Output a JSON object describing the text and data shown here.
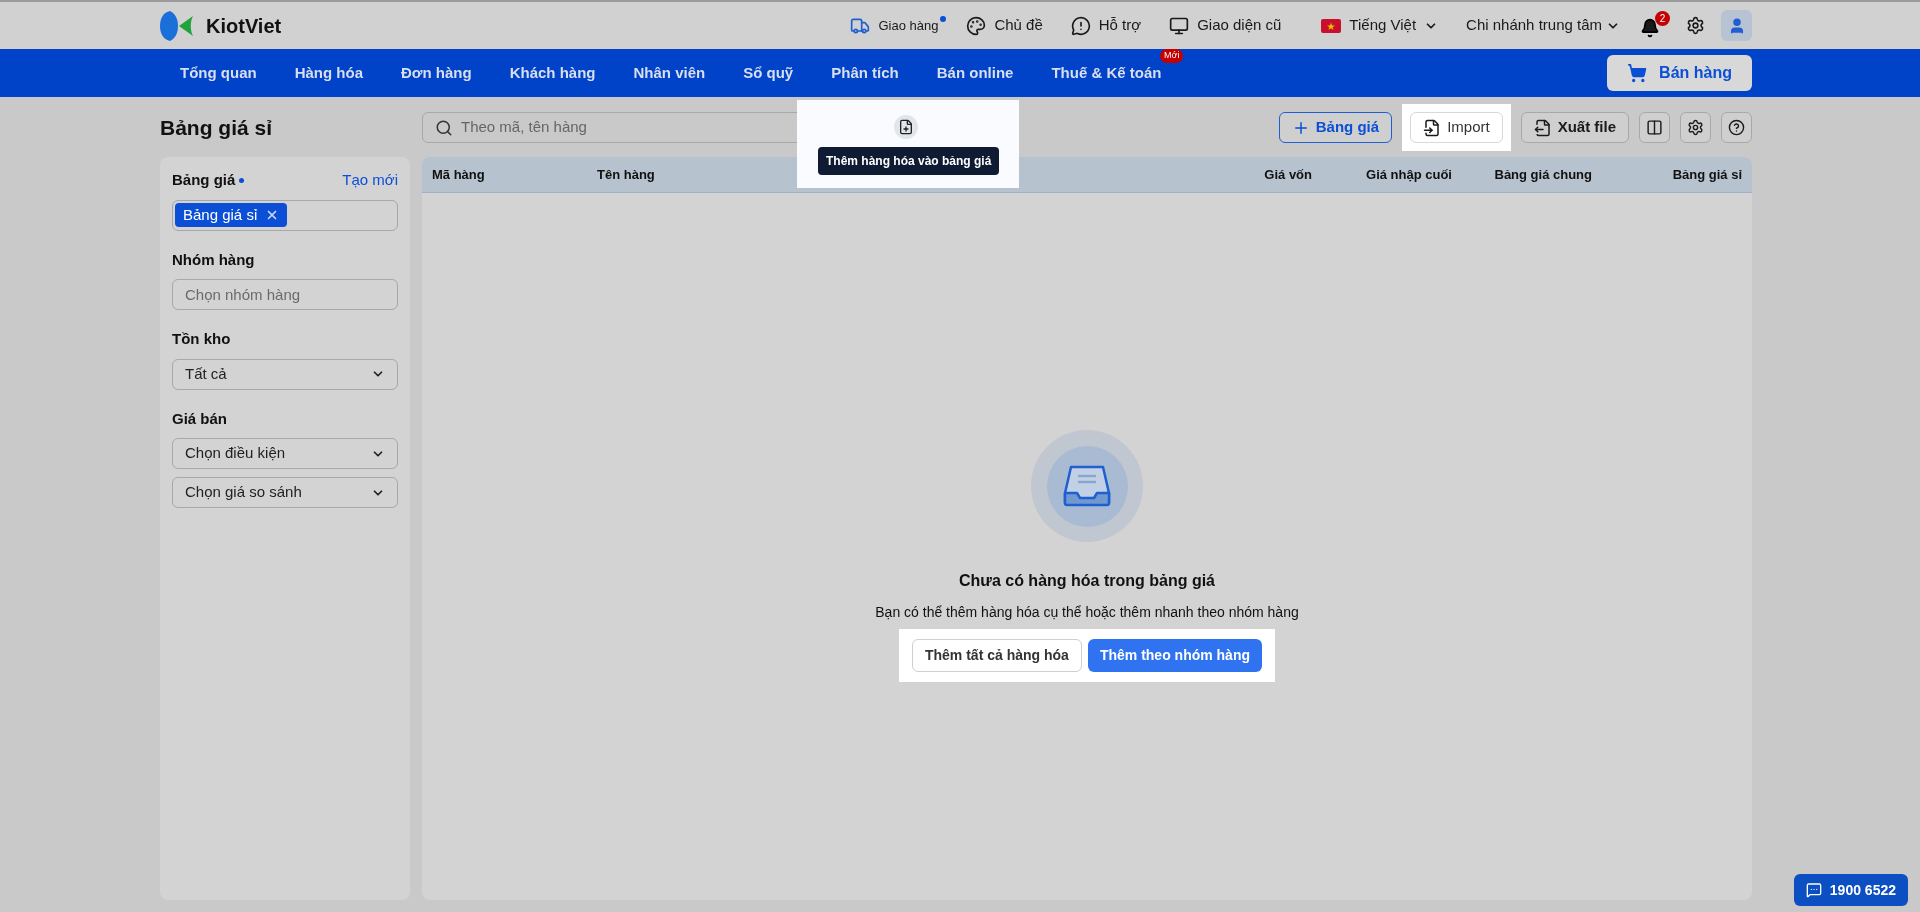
{
  "topbar": {
    "logo": "KiotViet",
    "links": [
      {
        "label": "Giao hàng",
        "kind": "delivery",
        "dot": true
      },
      {
        "label": "Chủ đề",
        "kind": "theme",
        "dot": false
      },
      {
        "label": "Hỗ trợ",
        "kind": "support",
        "dot": false
      },
      {
        "label": "Giao diện cũ",
        "kind": "monitor",
        "dot": false
      }
    ],
    "language": "Tiếng Việt",
    "branch": "Chi nhánh trung tâm",
    "notifications": "2"
  },
  "nav": {
    "items": [
      {
        "label": "Tổng quan"
      },
      {
        "label": "Hàng hóa"
      },
      {
        "label": "Đơn hàng"
      },
      {
        "label": "Khách hàng"
      },
      {
        "label": "Nhân viên"
      },
      {
        "label": "Sổ quỹ"
      },
      {
        "label": "Phân tích"
      },
      {
        "label": "Bán online"
      },
      {
        "label": "Thuế & Kế toán",
        "badge": "Mới"
      }
    ],
    "sell_button": "Bán hàng"
  },
  "page_title": "Bảng giá sỉ",
  "search": {
    "placeholder": "Theo mã, tên hàng",
    "add_highlighted": true,
    "tooltip": "Thêm hàng hóa vào bảng giá"
  },
  "toolbar": [
    {
      "kind": "add",
      "label": "Bảng giá",
      "highlighted": false
    },
    {
      "kind": "import",
      "label": "Import",
      "highlighted": true
    },
    {
      "kind": "export",
      "label": "Xuất file",
      "highlighted": false
    },
    {
      "kind": "columns",
      "highlighted": false
    },
    {
      "kind": "settings",
      "highlighted": false
    },
    {
      "kind": "help",
      "highlighted": false
    }
  ],
  "sidebar": {
    "sections": [
      {
        "title": "Bảng giá",
        "required": true,
        "link": "Tạo mới",
        "kind": "tags",
        "tags": [
          "Bảng giá sỉ"
        ]
      },
      {
        "title": "Nhóm hàng",
        "required": false,
        "kind": "input",
        "fields": [
          {
            "placeholder": "Chọn nhóm hàng"
          }
        ]
      },
      {
        "title": "Tồn kho",
        "required": false,
        "kind": "select",
        "fields": [
          {
            "value": "Tất cả"
          }
        ]
      },
      {
        "title": "Giá bán",
        "required": false,
        "kind": "select",
        "fields": [
          {
            "value": "Chọn điều kiện"
          },
          {
            "value": "Chọn giá so sánh"
          }
        ]
      }
    ]
  },
  "table": {
    "columns": [
      {
        "label": "Mã hàng"
      },
      {
        "label": "Tên hàng"
      },
      {
        "label": "Giá vốn"
      },
      {
        "label": "Giá nhập cuối"
      },
      {
        "label": "Bảng giá chung"
      },
      {
        "label": "Bảng giá sỉ"
      }
    ]
  },
  "empty_state": {
    "title": "Chưa có hàng hóa trong bảng giá",
    "message": "Bạn có thể thêm hàng hóa cụ thể hoặc thêm nhanh theo nhóm hàng",
    "actions_highlighted": true,
    "actions": [
      {
        "label": "Thêm tất cả hàng hóa",
        "kind": "secondary"
      },
      {
        "label": "Thêm theo nhóm hàng",
        "kind": "primary"
      }
    ]
  },
  "hotline": "1900 6522"
}
